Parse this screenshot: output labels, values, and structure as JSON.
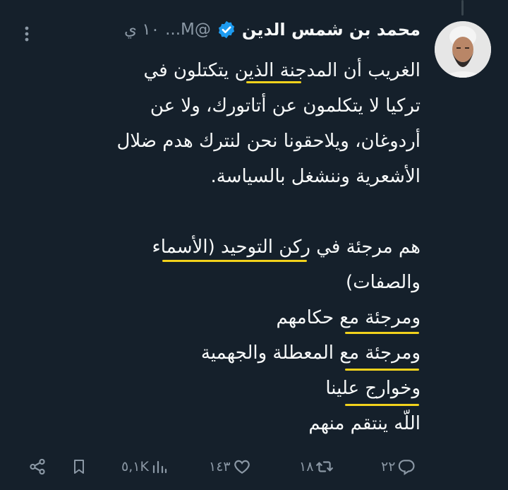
{
  "tweet": {
    "author_name": "محمد بن شمس الدين",
    "handle": "@M...",
    "time": "١٠ ي",
    "lines": [
      "الغريب أن المدجنة الذين يتكتلون في",
      "تركيا لا يتكلمون عن أتاتورك، ولا عن",
      "أردوغان، ويلاحقونا نحن لنترك هدم ضلال",
      "الأشعرية وننشغل بالسياسة.",
      "",
      "هم مرجئة في ركن التوحيد (الأسماء",
      "والصفات)",
      "ومرجئة مع حكامهم",
      "ومرجئة مع المعطلة والجهمية",
      "وخوارج علينا",
      "اللّه ينتقم منهم"
    ]
  },
  "actions": {
    "replies": "٢٢",
    "retweets": "١٨",
    "likes": "١٤٣",
    "views": "٥,١K"
  },
  "colors": {
    "background": "#15202b",
    "text": "#f7f9f9",
    "muted": "#8b98a5",
    "verified": "#1d9bf0",
    "highlight_underline": "#f2d21c"
  },
  "icons": [
    "verified-badge-icon",
    "more-options-icon",
    "reply-icon",
    "retweet-icon",
    "like-icon",
    "views-icon",
    "bookmark-icon",
    "share-icon"
  ]
}
